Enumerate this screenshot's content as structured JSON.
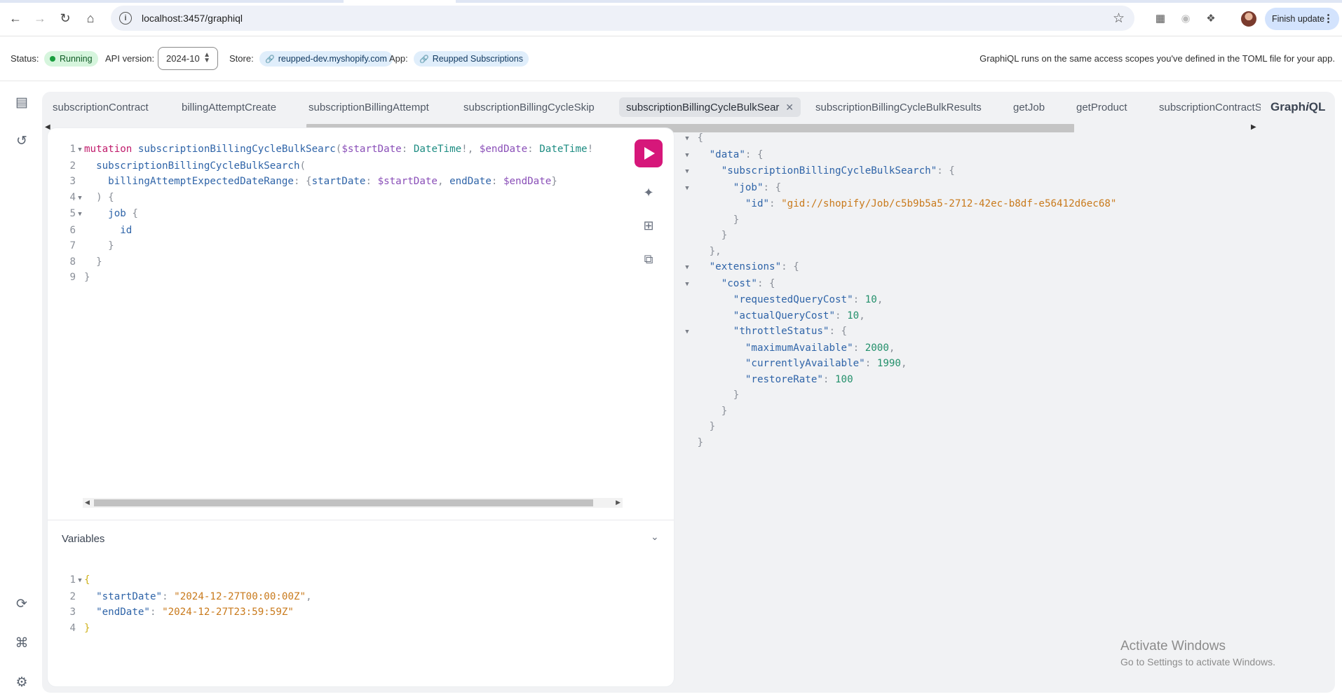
{
  "browser": {
    "url": "localhost:3457/graphiql",
    "finish_update_label": "Finish update"
  },
  "status_bar": {
    "status_label": "Status:",
    "status_value": "Running",
    "api_version_label": "API version:",
    "api_version_value": "2024-10",
    "store_label": "Store:",
    "store_value": "reupped-dev.myshopify.com",
    "app_label": "App:",
    "app_value": "Reupped Subscriptions",
    "scope_note": "GraphiQL runs on the same access scopes you've defined in the TOML file for your app."
  },
  "tabs": [
    {
      "label": "subscriptionContract"
    },
    {
      "label": "billingAttemptCreate"
    },
    {
      "label": "subscriptionBillingAttempt"
    },
    {
      "label": "subscriptionBillingCycleSkip"
    },
    {
      "label": "subscriptionBillingCycleBulkSearc",
      "active": true
    },
    {
      "label": "subscriptionBillingCycleBulkResults"
    },
    {
      "label": "getJob"
    },
    {
      "label": "getProduct"
    },
    {
      "label": "subscriptionContractS"
    }
  ],
  "logo": {
    "pre": "Graph",
    "italic": "i",
    "post": "QL"
  },
  "query_editor": {
    "line_numbers": [
      "1",
      "2",
      "3",
      "4",
      "5",
      "6",
      "7",
      "8",
      "9"
    ],
    "mutation_keyword": "mutation",
    "operation_name": "subscriptionBillingCycleBulkSearc",
    "var_start": "$startDate",
    "var_end": "$endDate",
    "type_datetime": "DateTime",
    "field_search": "subscriptionBillingCycleBulkSearch",
    "arg_range": "billingAttemptExpectedDateRange",
    "arg_start": "startDate",
    "arg_end": "endDate",
    "field_job": "job",
    "field_id": "id"
  },
  "variables": {
    "title": "Variables",
    "line_numbers": [
      "1",
      "2",
      "3",
      "4"
    ],
    "key_start": "\"startDate\"",
    "val_start": "\"2024-12-27T00:00:00Z\"",
    "key_end": "\"endDate\"",
    "val_end": "\"2024-12-27T23:59:59Z\""
  },
  "response": {
    "key_data": "\"data\"",
    "key_search": "\"subscriptionBillingCycleBulkSearch\"",
    "key_job": "\"job\"",
    "key_id": "\"id\"",
    "val_id": "\"gid://shopify/Job/c5b9b5a5-2712-42ec-b8df-e56412d6ec68\"",
    "key_extensions": "\"extensions\"",
    "key_cost": "\"cost\"",
    "key_requested": "\"requestedQueryCost\"",
    "val_requested": "10",
    "key_actual": "\"actualQueryCost\"",
    "val_actual": "10",
    "key_throttle": "\"throttleStatus\"",
    "key_max": "\"maximumAvailable\"",
    "val_max": "2000",
    "key_current": "\"currentlyAvailable\"",
    "val_current": "1990",
    "key_restore": "\"restoreRate\"",
    "val_restore": "100"
  },
  "watermark": {
    "line1": "Activate Windows",
    "line2": "Go to Settings to activate Windows."
  }
}
